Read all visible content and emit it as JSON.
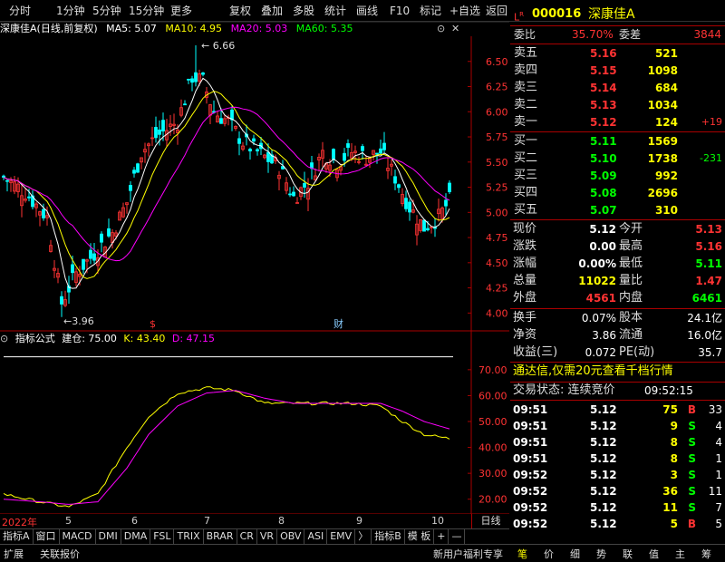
{
  "toolbar": {
    "left": [
      "分时",
      "1分钟",
      "5分钟",
      "15分钟",
      "更多"
    ],
    "right": [
      "复权",
      "叠加",
      "多股",
      "统计",
      "画线",
      "F10",
      "标记",
      "+自选",
      "返回"
    ]
  },
  "chart_header": {
    "name": "深康佳A",
    "mode": "(日线,前复权)",
    "ma5": "MA5: 5.07",
    "ma10": "MA10: 4.95",
    "ma20": "MA20: 5.03",
    "ma60": "MA60: 5.35"
  },
  "indicator_header": {
    "name": "指标公式",
    "jc": "建仓: 75.00",
    "k": "K: 43.40",
    "d": "D: 47.15"
  },
  "colors": {
    "ma5": "#ffffff",
    "ma10": "#ffff00",
    "ma20": "#ff00ff",
    "ma60": "#00ff00",
    "up": "#ff3333",
    "down": "#00ffff",
    "axis": "#aa0000"
  },
  "chart_data": [
    {
      "type": "candlestick",
      "y_ticks": [
        4.0,
        4.25,
        4.5,
        4.75,
        5.0,
        5.25,
        5.5,
        5.75,
        6.0,
        6.25,
        6.5
      ],
      "ylim": [
        3.85,
        6.75
      ],
      "annotations": [
        "6.66",
        "3.96"
      ],
      "markers": [
        "$",
        "财"
      ]
    },
    {
      "type": "line",
      "y_ticks": [
        20.0,
        30.0,
        40.0,
        50.0,
        60.0,
        70.0
      ],
      "ylim": [
        15,
        78
      ],
      "series": [
        {
          "name": "K"
        },
        {
          "name": "D"
        }
      ]
    }
  ],
  "x_dates": [
    "2022年",
    "5",
    "6",
    "7",
    "8",
    "9",
    "10"
  ],
  "day_label": "日线",
  "indicator_tabs": [
    "指标A",
    "窗口",
    "MACD",
    "DMI",
    "DMA",
    "FSL",
    "TRIX",
    "BRAR",
    "CR",
    "VR",
    "OBV",
    "ASI",
    "EMV",
    "〉",
    "指标B",
    "模 板",
    "+",
    "—"
  ],
  "bottom": {
    "left1": "扩展",
    "left2": "关联报价",
    "promo": "新用户福利专享",
    "tabs": [
      "笔",
      "价",
      "细",
      "势",
      "联",
      "值",
      "主",
      "筹"
    ]
  },
  "quote": {
    "code": "000016",
    "name": "深康佳A",
    "weibi_label": "委比",
    "weibi": "35.70%",
    "weicha_label": "委差",
    "weicha": "3844",
    "asks": [
      {
        "l": "卖五",
        "p": "5.16",
        "v": "521"
      },
      {
        "l": "卖四",
        "p": "5.15",
        "v": "1098"
      },
      {
        "l": "卖三",
        "p": "5.14",
        "v": "684"
      },
      {
        "l": "卖二",
        "p": "5.13",
        "v": "1034"
      },
      {
        "l": "卖一",
        "p": "5.12",
        "v": "124",
        "c": "+19"
      }
    ],
    "bids": [
      {
        "l": "买一",
        "p": "5.11",
        "v": "1569"
      },
      {
        "l": "买二",
        "p": "5.10",
        "v": "1738",
        "c": "-231"
      },
      {
        "l": "买三",
        "p": "5.09",
        "v": "992"
      },
      {
        "l": "买四",
        "p": "5.08",
        "v": "2696"
      },
      {
        "l": "买五",
        "p": "5.07",
        "v": "310"
      }
    ],
    "stats": [
      {
        "l1": "现价",
        "v1": "5.12",
        "l2": "今开",
        "v2": "5.13"
      },
      {
        "l1": "涨跌",
        "v1": "0.00",
        "l2": "最高",
        "v2": "5.16"
      },
      {
        "l1": "涨幅",
        "v1": "0.00%",
        "l2": "最低",
        "v2": "5.11"
      },
      {
        "l1": "总量",
        "v1": "11022",
        "l2": "量比",
        "v2": "1.47"
      },
      {
        "l1": "外盘",
        "v1": "4561",
        "l2": "内盘",
        "v2": "6461"
      }
    ],
    "stats2": [
      {
        "l1": "换手",
        "v1": "0.07%",
        "l2": "股本",
        "v2": "24.1亿"
      },
      {
        "l1": "净资",
        "v1": "3.86",
        "l2": "流通",
        "v2": "16.0亿"
      },
      {
        "l1": "收益(三)",
        "v1": "0.072",
        "l2": "PE(动)",
        "v2": "35.7"
      }
    ],
    "promo": "通达信,仅需20元查看千档行情",
    "status_label": "交易状态: 连续竞价",
    "status_time": "09:52:15",
    "ticks": [
      {
        "t": "09:51",
        "p": "5.12",
        "v": "75",
        "d": "B",
        "n": "33"
      },
      {
        "t": "09:51",
        "p": "5.12",
        "v": "9",
        "d": "S",
        "n": "4"
      },
      {
        "t": "09:51",
        "p": "5.12",
        "v": "8",
        "d": "S",
        "n": "4"
      },
      {
        "t": "09:51",
        "p": "5.12",
        "v": "8",
        "d": "S",
        "n": "1"
      },
      {
        "t": "09:52",
        "p": "5.12",
        "v": "3",
        "d": "S",
        "n": "1"
      },
      {
        "t": "09:52",
        "p": "5.12",
        "v": "36",
        "d": "S",
        "n": "11"
      },
      {
        "t": "09:52",
        "p": "5.12",
        "v": "11",
        "d": "S",
        "n": "7"
      },
      {
        "t": "09:52",
        "p": "5.12",
        "v": "5",
        "d": "B",
        "n": "5"
      }
    ]
  }
}
